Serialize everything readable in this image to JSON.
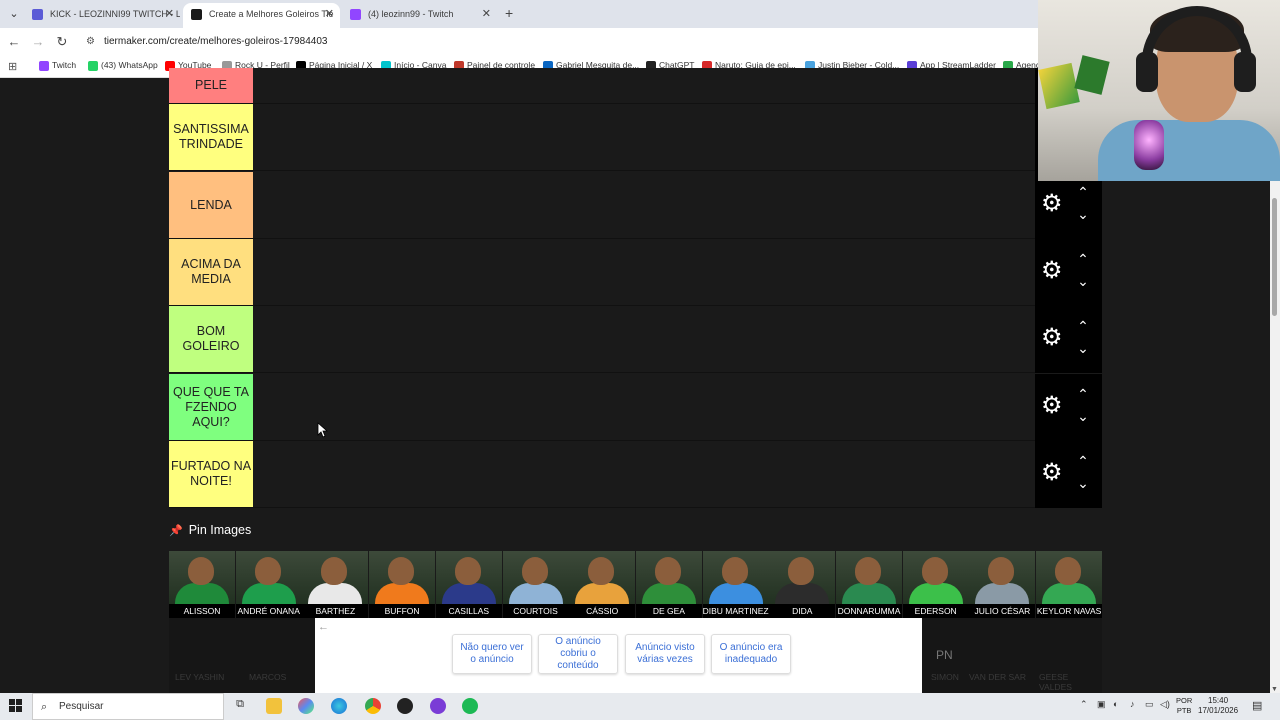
{
  "browser": {
    "tabs": [
      {
        "title": "KICK - LEOZINNI99 TWITCH - L",
        "active": false,
        "color": "#5b5bd6"
      },
      {
        "title": "Create a Melhores Goleiros Tie",
        "active": true,
        "color": "#1a1a1a"
      },
      {
        "title": "(4) leozinn99 - Twitch",
        "active": false,
        "color": "#9146ff"
      }
    ],
    "url": "tiermaker.com/create/melhores-goleiros-17984403",
    "bookmarks": [
      {
        "label": "Twitch",
        "color": "#9146ff"
      },
      {
        "label": "(43) WhatsApp",
        "color": "#25d366"
      },
      {
        "label": "YouTube",
        "color": "#ff0000"
      },
      {
        "label": "Rock U - Perfil",
        "color": "#999999"
      },
      {
        "label": "Página Inicial / X",
        "color": "#000000"
      },
      {
        "label": "Início - Canva",
        "color": "#00c4cc"
      },
      {
        "label": "Painel de controle",
        "color": "#c0392b"
      },
      {
        "label": "Gabriel Mesquita de...",
        "color": "#0a66c2"
      },
      {
        "label": "ChatGPT",
        "color": "#222222"
      },
      {
        "label": "Naruto: Guia de epi...",
        "color": "#d62828"
      },
      {
        "label": "Justin Bieber - Cold...",
        "color": "#4aa3df"
      },
      {
        "label": "App | StreamLadder",
        "color": "#5b3fd6"
      },
      {
        "label": "Agend",
        "color": "#2aa84a"
      }
    ]
  },
  "tiers": [
    {
      "label": "PELE",
      "color": "#ff7f7f"
    },
    {
      "label": "SANTISSIMA TRINDADE",
      "color": "#ffff7f"
    },
    {
      "label": "LENDA",
      "color": "#ffbf7f"
    },
    {
      "label": "ACIMA DA MEDIA",
      "color": "#ffdf7f"
    },
    {
      "label": "BOM GOLEIRO",
      "color": "#bfff7f"
    },
    {
      "label": "QUE QUE TA FZENDO AQUI?",
      "color": "#7fff7f"
    },
    {
      "label": "FURTADO NA NOITE!",
      "color": "#ffff7f"
    }
  ],
  "pin_images": {
    "heading": "Pin Images",
    "players": [
      {
        "name": "ALISSON",
        "kit": "#1f8a3a"
      },
      {
        "name": "ANDRÉ ONANA",
        "kit": "#1e9e4c"
      },
      {
        "name": "BARTHEZ",
        "kit": "#e8e8e8"
      },
      {
        "name": "BUFFON",
        "kit": "#f07a1c"
      },
      {
        "name": "CASILLAS",
        "kit": "#2b3a8a"
      },
      {
        "name": "COURTOIS",
        "kit": "#8fb3d6"
      },
      {
        "name": "CÁSSIO",
        "kit": "#e8a23c"
      },
      {
        "name": "DE GEA",
        "kit": "#2e8f3a"
      },
      {
        "name": "DIBU MARTINEZ",
        "kit": "#3c8fe0"
      },
      {
        "name": "DIDA",
        "kit": "#2c2c2c"
      },
      {
        "name": "DONNARUMMA",
        "kit": "#2a8a50"
      },
      {
        "name": "EDERSON",
        "kit": "#3cc04a"
      },
      {
        "name": "JULIO CÉSAR",
        "kit": "#8a9aa6"
      },
      {
        "name": "KEYLOR NAVAS",
        "kit": "#34a853"
      }
    ],
    "hidden_row": [
      "LEV YASHIN",
      "MARCOS",
      "SIMON",
      "VAN DER SAR",
      "GEESE VALDES"
    ]
  },
  "ad": {
    "buttons": [
      "Não quero ver o anúncio",
      "O anúncio cobriu o conteúdo",
      "Anúncio visto várias vezes",
      "O anúncio era inadequado"
    ],
    "logo": "PN"
  },
  "taskbar": {
    "search_placeholder": "Pesquisar",
    "lang_top": "POR",
    "lang_bottom": "PTB",
    "time": "15:40",
    "date": "17/01/2026"
  }
}
